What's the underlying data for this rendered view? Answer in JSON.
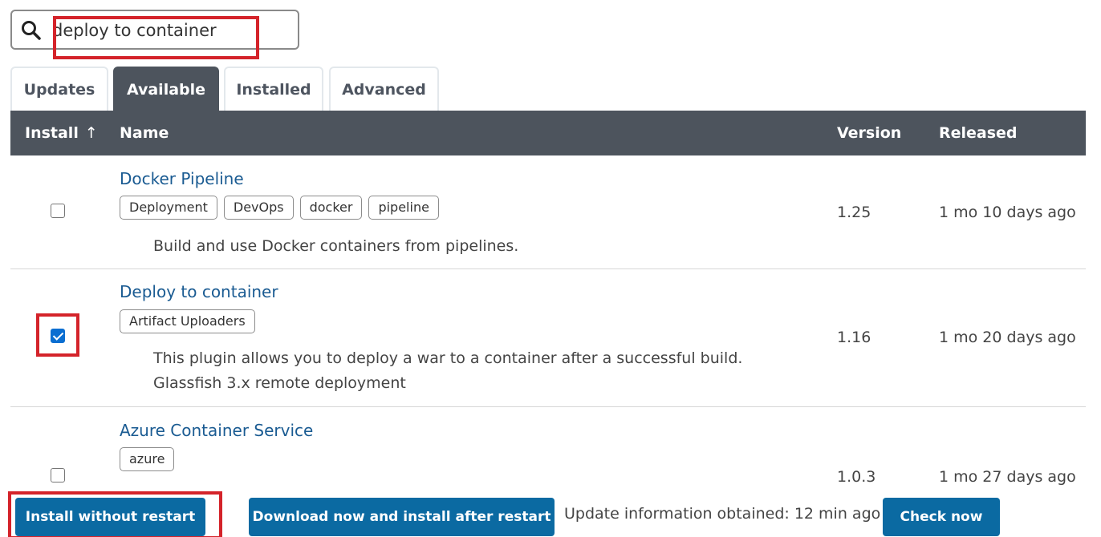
{
  "search": {
    "value": "deploy to container"
  },
  "tabs": [
    {
      "label": "Updates",
      "active": false
    },
    {
      "label": "Available",
      "active": true
    },
    {
      "label": "Installed",
      "active": false
    },
    {
      "label": "Advanced",
      "active": false
    }
  ],
  "table": {
    "headers": {
      "install": "Install",
      "sort_indicator": "↑",
      "name": "Name",
      "version": "Version",
      "released": "Released"
    },
    "rows": [
      {
        "checked": false,
        "name": "Docker Pipeline",
        "tags": [
          "Deployment",
          "DevOps",
          "docker",
          "pipeline"
        ],
        "description": [
          "Build and use Docker containers from pipelines."
        ],
        "version": "1.25",
        "released": "1 mo 10 days ago"
      },
      {
        "checked": true,
        "name": "Deploy to container",
        "tags": [
          "Artifact Uploaders"
        ],
        "description": [
          "This plugin allows you to deploy a war to a container after a successful build.",
          "Glassfish 3.x remote deployment"
        ],
        "version": "1.16",
        "released": "1 mo 20 days ago"
      },
      {
        "checked": false,
        "name": "Azure Container Service",
        "tags": [
          "azure"
        ],
        "description": [],
        "version": "1.0.3",
        "released": "1 mo 27 days ago"
      }
    ]
  },
  "bottom_bar": {
    "install_without_restart": "Install without restart",
    "download_install_after_restart": "Download now and install after restart",
    "update_info": "Update information obtained: 12 min ago",
    "check_now": "Check now"
  },
  "colors": {
    "header_bg": "#4d545d",
    "link": "#1a5b92",
    "button": "#0b6aa2",
    "highlight": "#d4232a"
  }
}
